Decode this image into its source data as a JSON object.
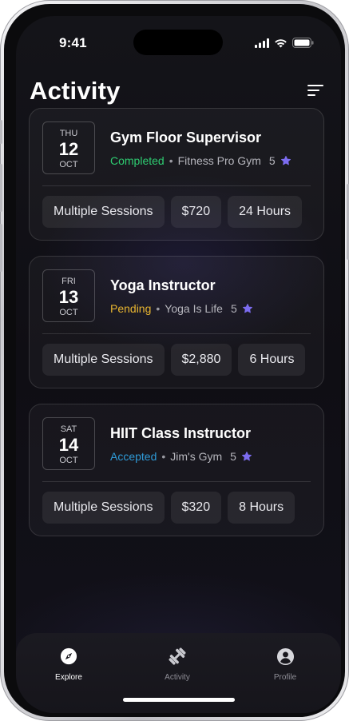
{
  "status_bar": {
    "time": "9:41"
  },
  "header": {
    "title": "Activity",
    "filter_icon": "filter-lines-icon"
  },
  "colors": {
    "completed": "#2ecc71",
    "pending": "#e8b530",
    "accepted": "#2f9bd8",
    "star": "#7c6cf0"
  },
  "activities": [
    {
      "dow": "THU",
      "day": "12",
      "month": "OCT",
      "title": "Gym Floor Supervisor",
      "status": "Completed",
      "gym": "Fitness Pro Gym",
      "rating": "5",
      "chips": [
        "Multiple Sessions",
        "$720",
        "24 Hours"
      ]
    },
    {
      "dow": "FRI",
      "day": "13",
      "month": "OCT",
      "title": "Yoga Instructor",
      "status": "Pending",
      "gym": "Yoga Is Life",
      "rating": "5",
      "chips": [
        "Multiple Sessions",
        "$2,880",
        "6 Hours"
      ]
    },
    {
      "dow": "SAT",
      "day": "14",
      "month": "OCT",
      "title": "HIIT Class Instructor",
      "status": "Accepted",
      "gym": "Jim's Gym",
      "rating": "5",
      "chips": [
        "Multiple Sessions",
        "$320",
        "8 Hours"
      ]
    }
  ],
  "tab_bar": {
    "tabs": [
      {
        "label": "Explore",
        "icon": "compass-icon",
        "active": true
      },
      {
        "label": "Activity",
        "icon": "dumbbell-icon",
        "active": false
      },
      {
        "label": "Profile",
        "icon": "user-icon",
        "active": false
      }
    ]
  }
}
